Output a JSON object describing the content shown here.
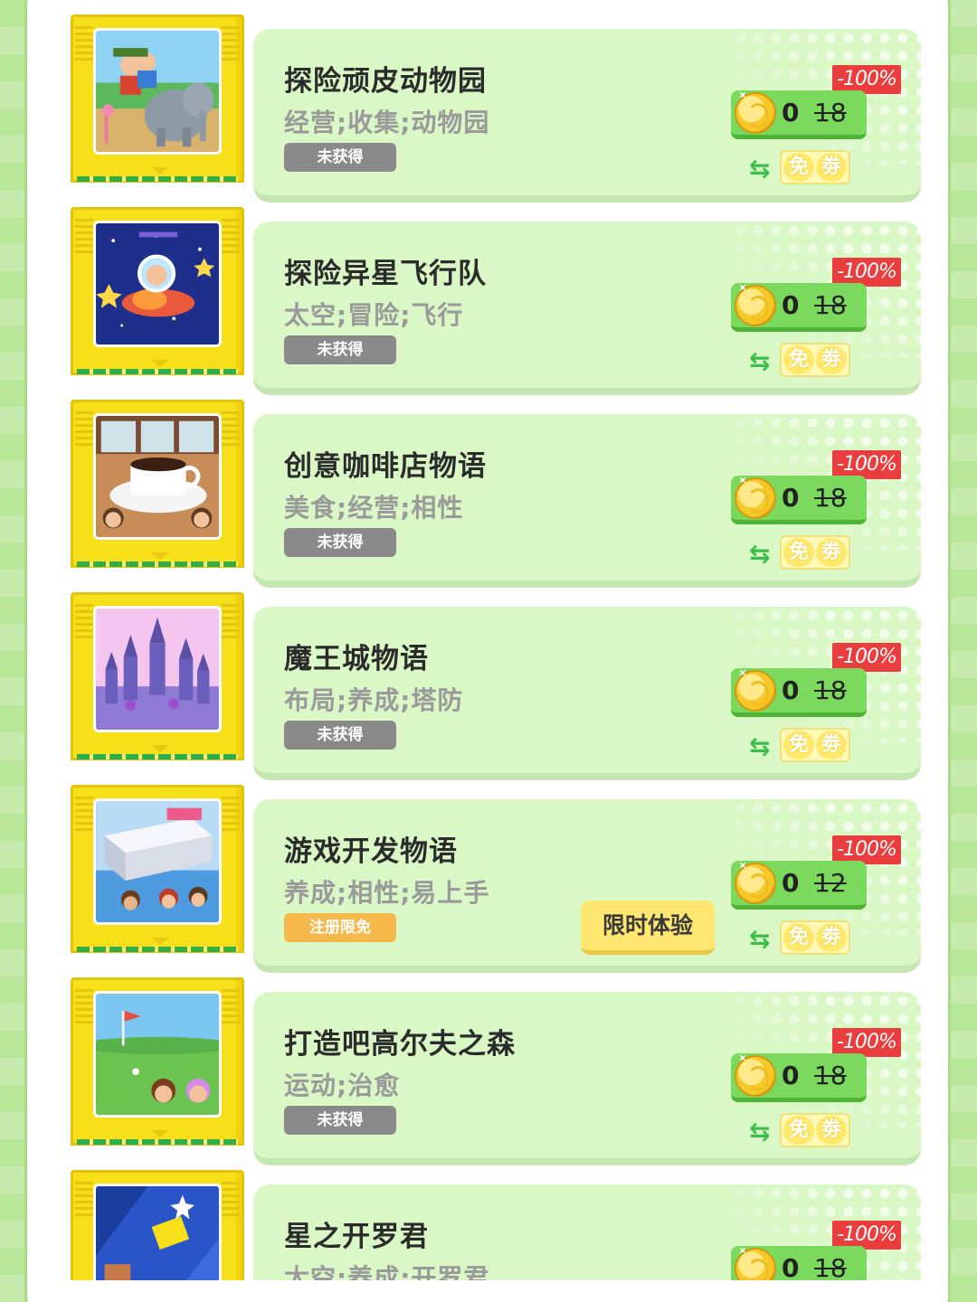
{
  "games": [
    {
      "title": "探险顽皮动物园",
      "tags": "经营;收集;动物园",
      "status": "未获得",
      "status_type": "locked",
      "discount": "-100%",
      "price_now": "0",
      "price_old": "18",
      "trial": "",
      "free_label": [
        "免",
        "劵"
      ],
      "swap_icon": "⇆",
      "art": "zoo"
    },
    {
      "title": "探险异星飞行队",
      "tags": "太空;冒险;飞行",
      "status": "未获得",
      "status_type": "locked",
      "discount": "-100%",
      "price_now": "0",
      "price_old": "18",
      "trial": "",
      "free_label": [
        "免",
        "劵"
      ],
      "swap_icon": "⇆",
      "art": "space"
    },
    {
      "title": "创意咖啡店物语",
      "tags": "美食;经营;相性",
      "status": "未获得",
      "status_type": "locked",
      "discount": "-100%",
      "price_now": "0",
      "price_old": "18",
      "trial": "",
      "free_label": [
        "免",
        "劵"
      ],
      "swap_icon": "⇆",
      "art": "cafe"
    },
    {
      "title": "魔王城物语",
      "tags": "布局;养成;塔防",
      "status": "未获得",
      "status_type": "locked",
      "discount": "-100%",
      "price_now": "0",
      "price_old": "18",
      "trial": "",
      "free_label": [
        "免",
        "劵"
      ],
      "swap_icon": "⇆",
      "art": "castle"
    },
    {
      "title": "游戏开发物语",
      "tags": "养成;相性;易上手",
      "status": "注册限免",
      "status_type": "promo",
      "discount": "-100%",
      "price_now": "0",
      "price_old": "12",
      "trial": "限时体验",
      "free_label": [
        "免",
        "劵"
      ],
      "swap_icon": "⇆",
      "art": "devstory"
    },
    {
      "title": "打造吧高尔夫之森",
      "tags": "运动;治愈",
      "status": "未获得",
      "status_type": "locked",
      "discount": "-100%",
      "price_now": "0",
      "price_old": "18",
      "trial": "",
      "free_label": [
        "免",
        "劵"
      ],
      "swap_icon": "⇆",
      "art": "golf"
    },
    {
      "title": "星之开罗君",
      "tags": "太空;养成;开罗君",
      "status": "",
      "status_type": "locked",
      "discount": "-100%",
      "price_now": "0",
      "price_old": "18",
      "trial": "",
      "free_label": [
        "免",
        "劵"
      ],
      "swap_icon": "⇆",
      "art": "star"
    }
  ],
  "colors": {
    "page_bg": "#b9e79a",
    "card_bg": "#d9f8c6",
    "cartridge": "#f7e01a",
    "discount_red": "#ea3d3d",
    "price_green": "#7bd95d",
    "status_gray": "#8a8a8a",
    "status_promo": "#f5b84b",
    "trial_yellow": "#ffe771"
  }
}
